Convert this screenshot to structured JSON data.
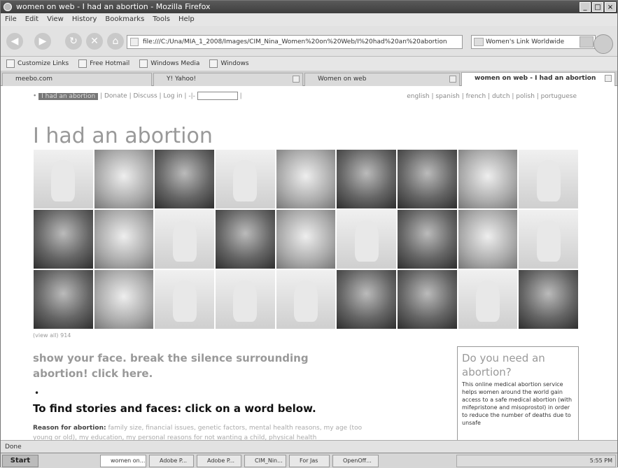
{
  "window": {
    "title": "women on web - I had an abortion - Mozilla Firefox"
  },
  "menu": [
    "File",
    "Edit",
    "View",
    "History",
    "Bookmarks",
    "Tools",
    "Help"
  ],
  "navigation": {
    "url": "file:///C:/Una/MIA_1_2008/Images/CIM_Nina_Women%20on%20Web/I%20had%20an%20abortion",
    "search_value": "Women's Link Worldwide"
  },
  "bookmarks": [
    "Customize Links",
    "Free Hotmail",
    "Windows Media",
    "Windows"
  ],
  "tabs": [
    {
      "label": "meebo.com"
    },
    {
      "label": "Y! Yahoo!"
    },
    {
      "label": "Women on web"
    },
    {
      "label": "women on web - I had an abortion"
    }
  ],
  "page": {
    "top_links": {
      "current": "I had an abortion",
      "links": [
        "Donate",
        "Discuss",
        "Log in",
        "-|-"
      ]
    },
    "languages": "english | spanish | french | dutch | polish | portuguese",
    "heading": "I had an abortion",
    "caption": "(view all) 914",
    "tagline": "show your face. break the silence surrounding abortion! click here.",
    "bullet": "•",
    "find_heading": "To find stories and faces: click on a word below.",
    "reasons_label": "Reason for abortion:",
    "reasons_text": "family size, financial issues, genetic factors, mental health reasons, my age (too young or old), my education, my personal reasons for not wanting a child, physical health",
    "sidebox": {
      "question": "Do you need an abortion?",
      "text": "This online medical abortion service helps women around the world gain access to a safe medical abortion (with mifepristone and misoprostol) in order to reduce the number of deaths due to unsafe"
    },
    "grid": [
      "placeholder",
      "photo",
      "photo",
      "placeholder",
      "photo",
      "photo",
      "photo",
      "photo",
      "placeholder",
      "photo",
      "photo",
      "placeholder",
      "photo",
      "photo",
      "placeholder",
      "photo",
      "photo",
      "placeholder",
      "photo",
      "photo",
      "placeholder",
      "placeholder",
      "placeholder",
      "photo",
      "photo",
      "placeholder",
      "photo"
    ]
  },
  "status": "Done",
  "taskbar": {
    "start": "Start",
    "buttons": [
      "women on...",
      "Adobe P...",
      "Adobe P...",
      "CIM_Nin...",
      "For Jas",
      "OpenOff..."
    ],
    "clock": "5:55 PM"
  }
}
